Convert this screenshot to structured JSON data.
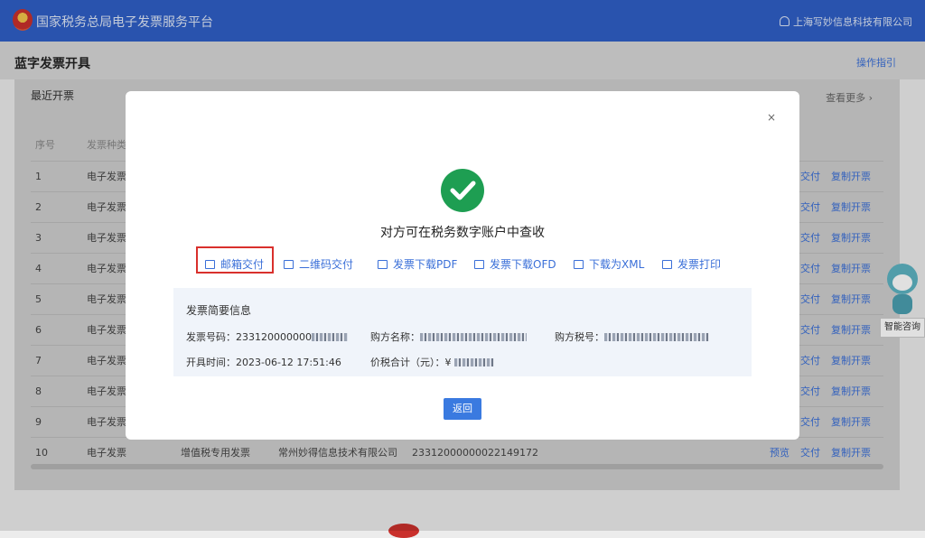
{
  "app": {
    "title": "国家税务总局电子发票服务平台",
    "user": "上海写妙信息科技有限公司"
  },
  "page": {
    "title": "蓝字发票开具",
    "help": "操作指引"
  },
  "recent": {
    "title": "最近开票",
    "more": "查看更多 ›",
    "headers": [
      "序号",
      "发票种类"
    ],
    "rows": [
      {
        "no": "1",
        "type": "电子发票",
        "kind": "",
        "seller": "",
        "number": "",
        "actions": [
          "交付",
          "复制开票"
        ]
      },
      {
        "no": "2",
        "type": "电子发票",
        "kind": "",
        "seller": "",
        "number": "",
        "actions": [
          "交付",
          "复制开票"
        ]
      },
      {
        "no": "3",
        "type": "电子发票",
        "kind": "",
        "seller": "",
        "number": "",
        "actions": [
          "交付",
          "复制开票"
        ]
      },
      {
        "no": "4",
        "type": "电子发票",
        "kind": "",
        "seller": "",
        "number": "",
        "actions": [
          "交付",
          "复制开票"
        ]
      },
      {
        "no": "5",
        "type": "电子发票",
        "kind": "",
        "seller": "",
        "number": "",
        "actions": [
          "交付",
          "复制开票"
        ]
      },
      {
        "no": "6",
        "type": "电子发票",
        "kind": "",
        "seller": "",
        "number": "",
        "actions": [
          "交付",
          "复制开票"
        ]
      },
      {
        "no": "7",
        "type": "电子发票",
        "kind": "",
        "seller": "",
        "number": "",
        "actions": [
          "交付",
          "复制开票"
        ]
      },
      {
        "no": "8",
        "type": "电子发票",
        "kind": "",
        "seller": "",
        "number": "",
        "actions": [
          "交付",
          "复制开票"
        ]
      },
      {
        "no": "9",
        "type": "电子发票",
        "kind": "",
        "seller": "",
        "number": "",
        "actions": [
          "交付",
          "复制开票"
        ]
      },
      {
        "no": "10",
        "type": "电子发票",
        "kind": "增值税专用发票",
        "seller": "常州妙得信息技术有限公司",
        "number": "23312000000022149172",
        "actions": [
          "预览",
          "交付",
          "复制开票"
        ]
      }
    ]
  },
  "assistant": {
    "label": "智能咨询"
  },
  "modal": {
    "close": "×",
    "message": "对方可在税务数字账户中查收",
    "actions": [
      "邮箱交付",
      "二维码交付",
      "发票下载PDF",
      "发票下载OFD",
      "下载为XML",
      "发票打印"
    ],
    "info": {
      "title": "发票简要信息",
      "invoice_no_label": "发票号码：",
      "invoice_no": "233120000000",
      "buyer_name_label": "购方名称：",
      "buyer_tax_label": "购方税号：",
      "issue_time_label": "开具时间：",
      "issue_time": "2023-06-12 17:51:46",
      "total_label": "价税合计（元）：",
      "total_prefix": "¥"
    },
    "back": "返回"
  },
  "colors": {
    "topbar": "#2f5fc7",
    "link": "#3a6fd8",
    "success": "#1e9e52",
    "highlight": "#d9302c",
    "primary_button": "#3a7ae0"
  }
}
